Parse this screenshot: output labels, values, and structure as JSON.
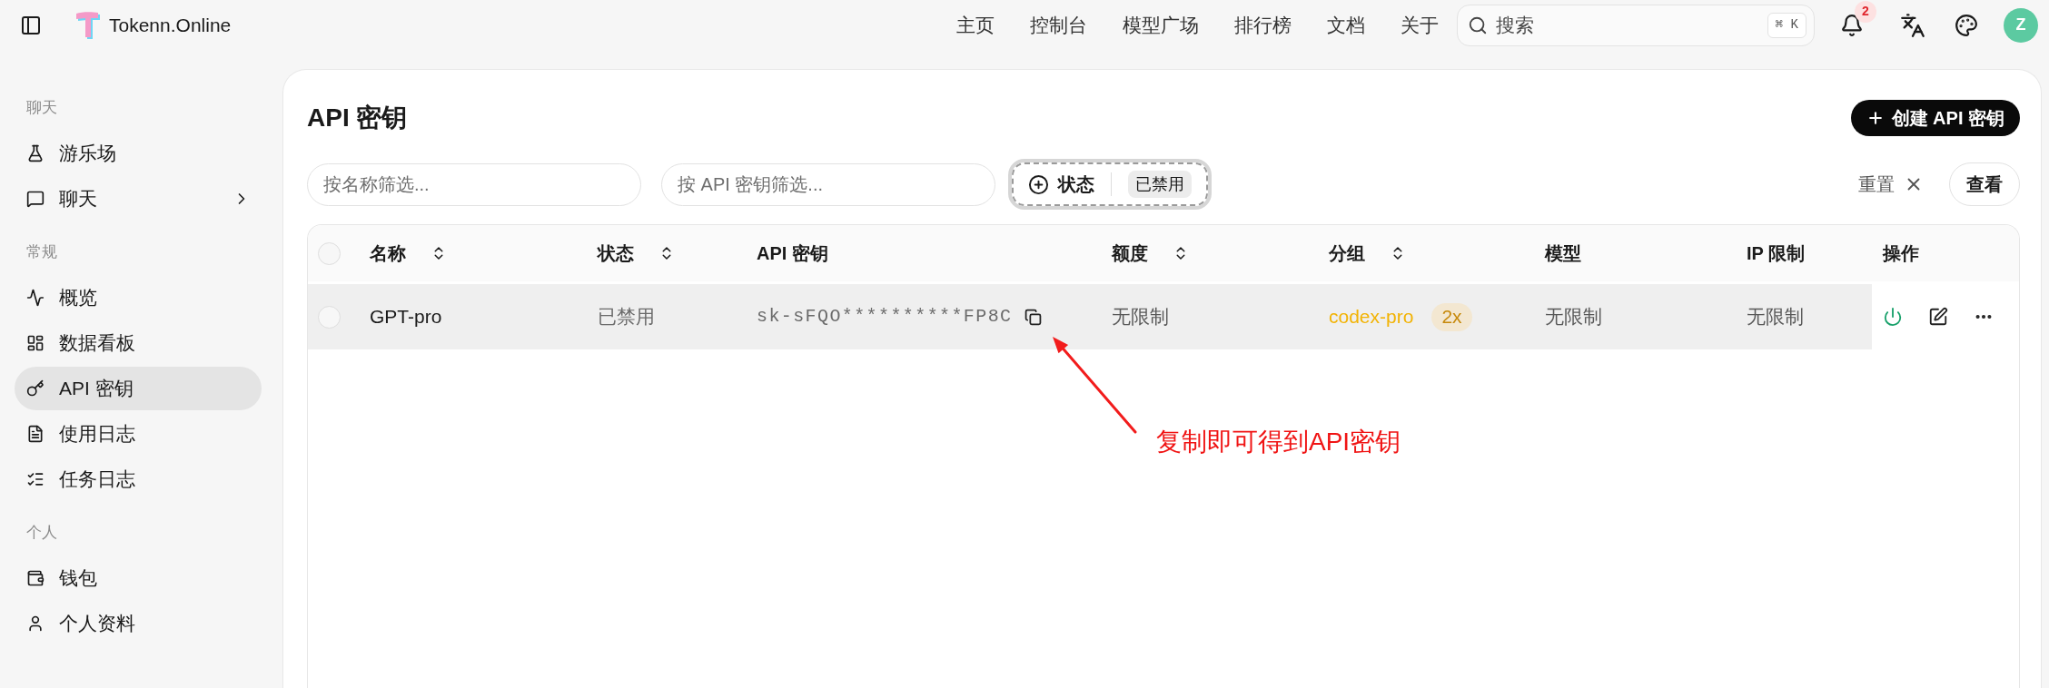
{
  "topbar": {
    "brand": "Tokenn.Online",
    "nav": [
      {
        "label": "主页"
      },
      {
        "label": "控制台"
      },
      {
        "label": "模型广场"
      },
      {
        "label": "排行榜"
      },
      {
        "label": "文档"
      },
      {
        "label": "关于"
      }
    ],
    "search": {
      "placeholder": "搜索",
      "shortcut": "⌘ K"
    },
    "notifications": {
      "count": "2"
    },
    "avatar": {
      "initial": "Z"
    }
  },
  "sidebar": {
    "sections": [
      {
        "title": "聊天",
        "items": [
          {
            "kind": "link",
            "label": "游乐场",
            "selected": false
          },
          {
            "kind": "group",
            "label": "聊天",
            "selected": false,
            "expanded": false
          }
        ]
      },
      {
        "title": "常规",
        "items": [
          {
            "kind": "link",
            "label": "概览",
            "selected": false
          },
          {
            "kind": "link",
            "label": "数据看板",
            "selected": false
          },
          {
            "kind": "link",
            "label": "API 密钥",
            "selected": true
          },
          {
            "kind": "link",
            "label": "使用日志",
            "selected": false
          },
          {
            "kind": "link",
            "label": "任务日志",
            "selected": false
          }
        ]
      },
      {
        "title": "个人",
        "items": [
          {
            "kind": "link",
            "label": "钱包",
            "selected": false
          },
          {
            "kind": "link",
            "label": "个人资料",
            "selected": false
          }
        ]
      }
    ]
  },
  "page": {
    "title": "API 密钥",
    "create_button": "创建 API 密钥"
  },
  "filters": {
    "name": {
      "placeholder": "按名称筛选..."
    },
    "api_key": {
      "placeholder": "按 API 密钥筛选..."
    },
    "status": {
      "label": "状态",
      "value": "已禁用"
    },
    "reset": "重置",
    "view": "查看"
  },
  "table": {
    "header_checkbox": {
      "checked": false
    },
    "columns": [
      {
        "label": "名称",
        "sortable": true
      },
      {
        "label": "状态",
        "sortable": true
      },
      {
        "label": "API 密钥",
        "sortable": false
      },
      {
        "label": "额度",
        "sortable": true
      },
      {
        "label": "分组",
        "sortable": true
      },
      {
        "label": "模型",
        "sortable": false
      },
      {
        "label": "IP 限制",
        "sortable": false
      },
      {
        "label": "操作",
        "sortable": false
      }
    ],
    "rows": [
      {
        "checked": false,
        "name": "GPT-pro",
        "status": "已禁用",
        "api_key": "sk-sFQO**********FP8C",
        "quota": "无限制",
        "group": "codex-pro",
        "group_ratio": "2x",
        "model": "无限制",
        "ip_limit": "无限制"
      }
    ]
  },
  "annotation": {
    "text": "复制即可得到API密钥"
  }
}
